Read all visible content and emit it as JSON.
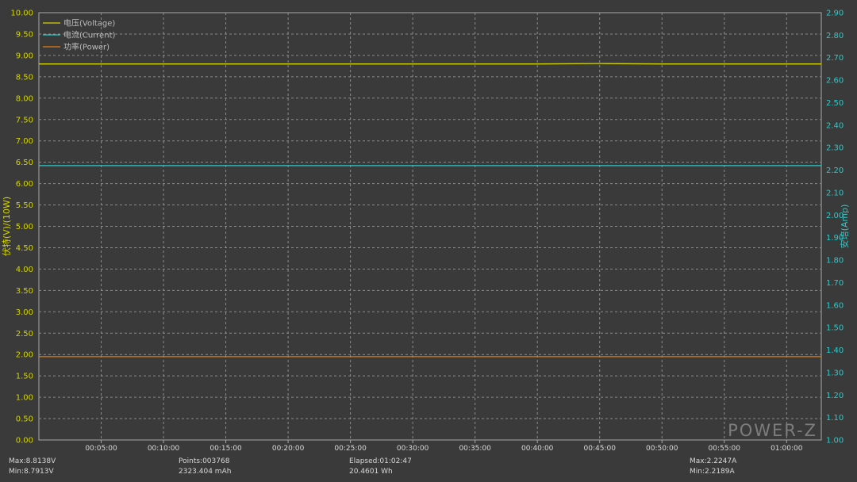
{
  "chart_data": {
    "type": "line",
    "y_left": {
      "label": "伏特(V)/(10W)",
      "min": 0,
      "max": 10,
      "step": 0.5,
      "color": "#d4d400"
    },
    "y_right": {
      "label": "安培(Amp)",
      "min": 1.0,
      "max": 2.9,
      "step": 0.1,
      "color": "#2ec8c8"
    },
    "x_axis": {
      "min": "00:00:00",
      "max": "01:02:47",
      "ticks": [
        "00:05:00",
        "00:10:00",
        "00:15:00",
        "00:20:00",
        "00:25:00",
        "00:30:00",
        "00:35:00",
        "00:40:00",
        "00:45:00",
        "00:50:00",
        "00:55:00",
        "01:00:00"
      ]
    },
    "grid": true,
    "legend_position": "top-left",
    "series": [
      {
        "name": "电压(Voltage)",
        "axis": "left",
        "color": "#d4d400",
        "points": [
          [
            "00:00:00",
            8.8
          ],
          [
            "00:40:00",
            8.8
          ],
          [
            "00:45:00",
            8.81
          ],
          [
            "00:50:00",
            8.8
          ],
          [
            "01:02:47",
            8.8
          ]
        ]
      },
      {
        "name": "电流(Current)",
        "axis": "right",
        "color": "#2ec8c8",
        "points": [
          [
            "00:00:00",
            2.22
          ],
          [
            "01:02:47",
            2.22
          ]
        ]
      },
      {
        "name": "功率(Power)",
        "axis": "left",
        "color": "#e07a10",
        "points": [
          [
            "00:00:00",
            1.95
          ],
          [
            "01:02:47",
            1.95
          ]
        ]
      }
    ],
    "watermark": "POWER-Z"
  },
  "stats": {
    "voltage_max": "Max:8.8138V",
    "voltage_min": "Min:8.7913V",
    "points": "Points:003768",
    "capacity": "2323.404 mAh",
    "elapsed": "Elapsed:01:02:47",
    "energy": "20.4601 Wh",
    "current_max": "Max:2.2247A",
    "current_min": "Min:2.2189A"
  }
}
